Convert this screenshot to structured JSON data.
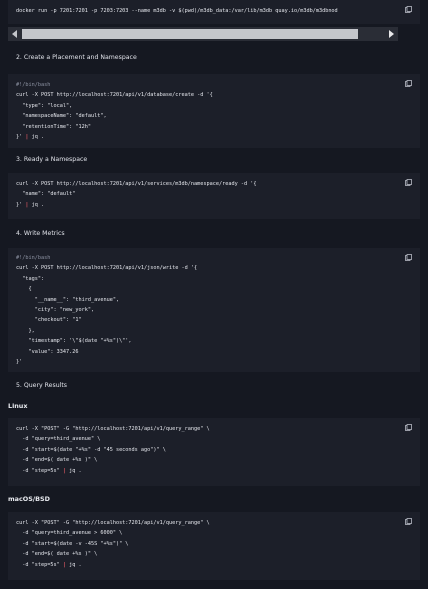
{
  "block0": {
    "lines": [
      "docker run -p 7201:7201 -p 7203:7203 --name m3db -v $(pwd)/m3db_data:/var/lib/m3db quay.io/m3db/m3dbnod"
    ]
  },
  "sections": {
    "s2": "2. Create a Placement and Namespace",
    "s3": "3. Ready a Namespace",
    "s4": "4. Write Metrics",
    "s5": "5. Query Results",
    "linux": "Linux",
    "mac": "macOS/BSD"
  },
  "block1": {
    "lines": [
      "#!/bin/bash",
      "curl -X POST http://localhost:7201/api/v1/database/create -d '{",
      "  \"type\": \"local\",",
      "  \"namespaceName\": \"default\",",
      "  \"retentionTime\": \"12h\"",
      "}' | jq ."
    ]
  },
  "block2": {
    "lines": [
      "curl -X POST http://localhost:7201/api/v1/services/m3db/namespace/ready -d '{",
      "  \"name\": \"default\"",
      "}' | jq ."
    ]
  },
  "block3": {
    "lines": [
      "#!/bin/bash",
      "curl -X POST http://localhost:7201/api/v1/json/write -d '{",
      "  \"tags\":",
      "    {",
      "      \"__name__\": \"third_avenue\",",
      "      \"city\": \"new_york\",",
      "      \"checkout\": \"1\"",
      "    },",
      "    \"timestamp\": '\\\"$(date \"+%s\")\\\"',",
      "    \"value\": 3347.26",
      "}'"
    ]
  },
  "block4": {
    "lines": [
      "curl -X \"POST\" -G \"http://localhost:7201/api/v1/query_range\" \\",
      "  -d \"query=third_avenue\" \\",
      "  -d \"start=$(date \"+%s\" -d \"45 seconds ago\")\" \\",
      "  -d \"end=$( date +%s )\" \\",
      "  -d \"step=5s\" | jq ."
    ]
  },
  "block5": {
    "lines": [
      "curl -X \"POST\" -G \"http://localhost:7201/api/v1/query_range\" \\",
      "  -d \"query=third_avenue > 6000\" \\",
      "  -d \"start=$(date -v -45S \"+%s\")\" \\",
      "  -d \"end=$( date +%s )\" \\",
      "  -d \"step=5s\" | jq ."
    ]
  },
  "icons": {
    "copy": "copy-icon",
    "scroll_left": "scroll-left-arrow-icon",
    "scroll_right": "scroll-right-arrow-icon"
  },
  "colors": {
    "background": "#151821",
    "code_background": "#1c1f29",
    "pipe": "#e05a63",
    "comment": "#8d93a3"
  }
}
